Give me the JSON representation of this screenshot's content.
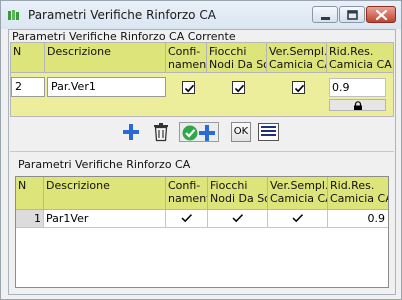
{
  "window": {
    "title": "Parametri Verifiche Rinforzo CA"
  },
  "current": {
    "label": "Parametri Verifiche Rinforzo CA Corrente",
    "headers": {
      "n": "N",
      "descrizione": "Descrizione",
      "confinamento": [
        "Confi-",
        "namento"
      ],
      "fiocchi": [
        "Fiocchi",
        "Nodi Da Soll"
      ],
      "versempl": [
        "Ver.Sempl.",
        "Camicia CA"
      ],
      "rid": [
        "Rid.Res.",
        "Camicia CA"
      ]
    },
    "row": {
      "n": "2",
      "descrizione": "Par.Ver1",
      "confinamento": true,
      "fiocchi": true,
      "versempl": true,
      "rid": "0.9"
    }
  },
  "toolbar": {
    "add_icon": "plus-icon",
    "delete_icon": "trash-icon",
    "confirm_add_icon": "check-plus-icon",
    "ok_label": "OK",
    "list_icon": "list-icon"
  },
  "saved": {
    "label": "Parametri Verifiche Rinforzo CA",
    "headers": {
      "n": "N",
      "descrizione": "Descrizione",
      "confinamento": [
        "Confi-",
        "namento"
      ],
      "fiocchi": [
        "Fiocchi",
        "Nodi Da Soll"
      ],
      "versempl": [
        "Ver.Sempl.",
        "Camicia CA"
      ],
      "rid": [
        "Rid.Res.",
        "Camicia CA"
      ]
    },
    "rows": [
      {
        "n": "1",
        "descrizione": "Par1Ver",
        "confinamento": true,
        "fiocchi": true,
        "versempl": true,
        "rid": "0.9"
      }
    ]
  }
}
